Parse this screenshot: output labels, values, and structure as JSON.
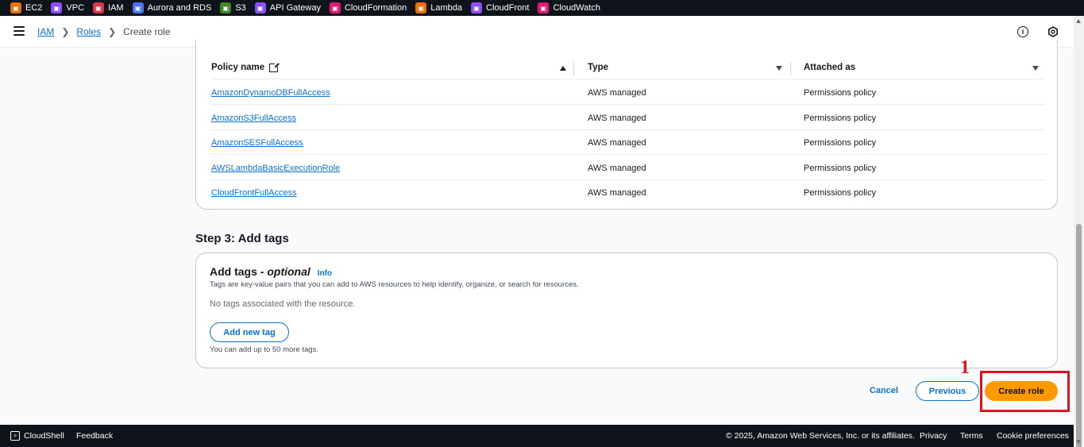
{
  "services": [
    {
      "label": "EC2",
      "color": "#ed7100",
      "icon": "ec2-icon"
    },
    {
      "label": "VPC",
      "color": "#8c4fff",
      "icon": "vpc-icon"
    },
    {
      "label": "IAM",
      "color": "#dd344c",
      "icon": "iam-icon"
    },
    {
      "label": "Aurora and RDS",
      "color": "#4d72f3",
      "icon": "rds-icon"
    },
    {
      "label": "S3",
      "color": "#3f8624",
      "icon": "s3-icon"
    },
    {
      "label": "API Gateway",
      "color": "#8c4fff",
      "icon": "api-gateway-icon"
    },
    {
      "label": "CloudFormation",
      "color": "#e7157b",
      "icon": "cloudformation-icon"
    },
    {
      "label": "Lambda",
      "color": "#ed7100",
      "icon": "lambda-icon"
    },
    {
      "label": "CloudFront",
      "color": "#8c4fff",
      "icon": "cloudfront-icon"
    },
    {
      "label": "CloudWatch",
      "color": "#e7157b",
      "icon": "cloudwatch-icon"
    }
  ],
  "breadcrumb": {
    "iam": "IAM",
    "roles": "Roles",
    "current": "Create role"
  },
  "policy_table": {
    "headers": {
      "policy_name": "Policy name",
      "type": "Type",
      "attached_as": "Attached as"
    },
    "rows": [
      {
        "name": "AmazonDynamoDBFullAccess",
        "type": "AWS managed",
        "attached": "Permissions policy"
      },
      {
        "name": "AmazonS3FullAccess",
        "type": "AWS managed",
        "attached": "Permissions policy"
      },
      {
        "name": "AmazonSESFullAccess",
        "type": "AWS managed",
        "attached": "Permissions policy"
      },
      {
        "name": "AWSLambdaBasicExecutionRole",
        "type": "AWS managed",
        "attached": "Permissions policy"
      },
      {
        "name": "CloudFrontFullAccess",
        "type": "AWS managed",
        "attached": "Permissions policy"
      }
    ]
  },
  "step3": {
    "heading": "Step 3: Add tags",
    "title": "Add tags - ",
    "title_optional": "optional",
    "info": "Info",
    "description": "Tags are key-value pairs that you can add to AWS resources to help identify, organize, or search for resources.",
    "empty": "No tags associated with the resource.",
    "add_button": "Add new tag",
    "limit": "You can add up to 50 more tags."
  },
  "actions": {
    "cancel": "Cancel",
    "previous": "Previous",
    "create": "Create role"
  },
  "annotation": {
    "number": "1",
    "color": "#e0121b"
  },
  "footer": {
    "cloudshell": "CloudShell",
    "feedback": "Feedback",
    "copyright": "© 2025, Amazon Web Services, Inc. or its affiliates.",
    "privacy": "Privacy",
    "terms": "Terms",
    "cookies": "Cookie preferences"
  },
  "colors": {
    "link": "#0972d3",
    "primary_button": "#ff9900",
    "top_bar": "#0f141a"
  }
}
